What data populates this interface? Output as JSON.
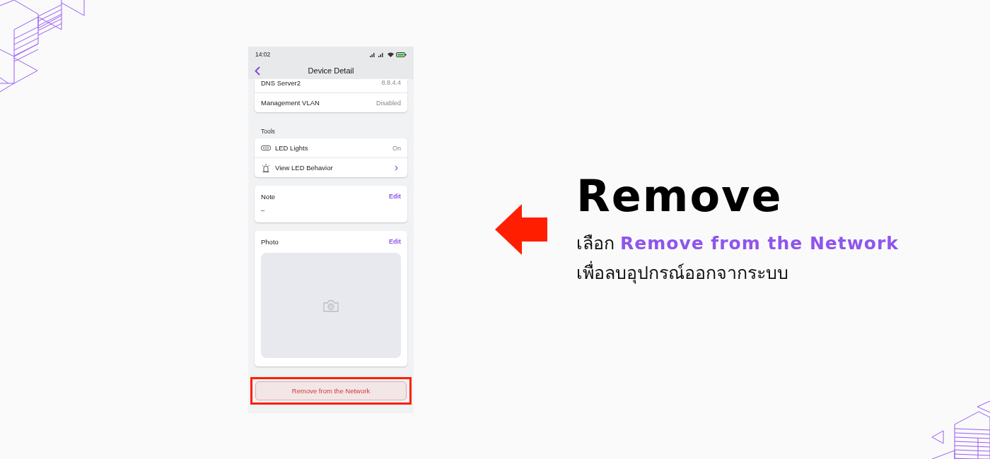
{
  "status_bar": {
    "time": "14:02"
  },
  "header": {
    "title": "Device Detail"
  },
  "sections": [
    {
      "kind": "list",
      "rows": [
        {
          "kind": "value",
          "label": "DNS Server2",
          "value": "8.8.4.4"
        },
        {
          "kind": "value",
          "label": "Management VLAN",
          "value": "Disabled"
        }
      ]
    },
    {
      "kind": "list",
      "heading": "Tools",
      "rows": [
        {
          "kind": "value",
          "label": "LED Lights",
          "value": "On"
        },
        {
          "kind": "link",
          "label": "View LED Behavior"
        }
      ]
    },
    {
      "kind": "note",
      "title": "Note",
      "action": "Edit",
      "value": "–"
    },
    {
      "kind": "photo",
      "title": "Photo",
      "action": "Edit"
    }
  ],
  "remove_button": {
    "label": "Remove from the Network",
    "highlighted": true
  },
  "caption": {
    "title": "Remove",
    "lines": [
      "เลือก **Remove from the Network**",
      "เพื่อลบอุปกรณ์ออกจากระบบ"
    ]
  }
}
